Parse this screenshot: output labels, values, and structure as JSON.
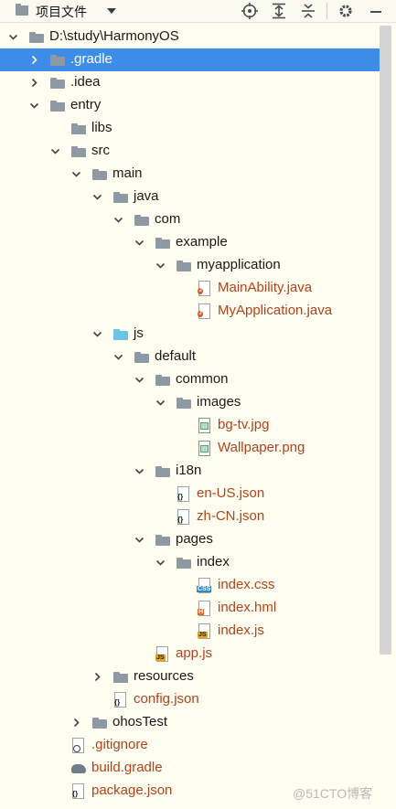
{
  "toolbar": {
    "project_label": "项目文件",
    "buttons": [
      "locate-icon",
      "expand-all-icon",
      "collapse-all-icon",
      "gear-icon",
      "minimize-icon"
    ]
  },
  "tree": [
    {
      "label": "D:\\study\\HarmonyOS",
      "depth": 0,
      "expanded": true,
      "icon": "folder",
      "selected": false
    },
    {
      "label": ".gradle",
      "depth": 1,
      "expanded": false,
      "icon": "folder",
      "selected": true
    },
    {
      "label": ".idea",
      "depth": 1,
      "expanded": false,
      "icon": "folder",
      "selected": false
    },
    {
      "label": "entry",
      "depth": 1,
      "expanded": true,
      "icon": "folder",
      "selected": false
    },
    {
      "label": "libs",
      "depth": 2,
      "icon": "folder",
      "selected": false
    },
    {
      "label": "src",
      "depth": 2,
      "expanded": true,
      "icon": "folder",
      "selected": false
    },
    {
      "label": "main",
      "depth": 3,
      "expanded": true,
      "icon": "folder",
      "selected": false
    },
    {
      "label": "java",
      "depth": 4,
      "expanded": true,
      "icon": "folder",
      "selected": false
    },
    {
      "label": "com",
      "depth": 5,
      "expanded": true,
      "icon": "folder",
      "selected": false
    },
    {
      "label": "example",
      "depth": 6,
      "expanded": true,
      "icon": "folder",
      "selected": false
    },
    {
      "label": "myapplication",
      "depth": 7,
      "expanded": true,
      "icon": "folder",
      "selected": false
    },
    {
      "label": "MainAbility.java",
      "depth": 8,
      "icon": "java-file",
      "red": true
    },
    {
      "label": "MyApplication.java",
      "depth": 8,
      "icon": "java-file",
      "red": true
    },
    {
      "label": "js",
      "depth": 4,
      "expanded": true,
      "icon": "folder-blue",
      "selected": false
    },
    {
      "label": "default",
      "depth": 5,
      "expanded": true,
      "icon": "folder",
      "selected": false
    },
    {
      "label": "common",
      "depth": 6,
      "expanded": true,
      "icon": "folder",
      "selected": false
    },
    {
      "label": "images",
      "depth": 7,
      "expanded": true,
      "icon": "folder",
      "selected": false
    },
    {
      "label": "bg-tv.jpg",
      "depth": 8,
      "icon": "image-file",
      "red": true
    },
    {
      "label": "Wallpaper.png",
      "depth": 8,
      "icon": "image-file",
      "red": true
    },
    {
      "label": "i18n",
      "depth": 6,
      "expanded": true,
      "icon": "folder",
      "selected": false
    },
    {
      "label": "en-US.json",
      "depth": 7,
      "icon": "json-file",
      "red": true
    },
    {
      "label": "zh-CN.json",
      "depth": 7,
      "icon": "json-file",
      "red": true
    },
    {
      "label": "pages",
      "depth": 6,
      "expanded": true,
      "icon": "folder",
      "selected": false
    },
    {
      "label": "index",
      "depth": 7,
      "expanded": true,
      "icon": "folder",
      "selected": false
    },
    {
      "label": "index.css",
      "depth": 8,
      "icon": "css-file",
      "red": true
    },
    {
      "label": "index.hml",
      "depth": 8,
      "icon": "hml-file",
      "red": true
    },
    {
      "label": "index.js",
      "depth": 8,
      "icon": "js-file",
      "red": true
    },
    {
      "label": "app.js",
      "depth": 6,
      "icon": "js-file",
      "red": true
    },
    {
      "label": "resources",
      "depth": 4,
      "expanded": false,
      "icon": "folder",
      "selected": false
    },
    {
      "label": "config.json",
      "depth": 4,
      "icon": "json-file",
      "red": true
    },
    {
      "label": "ohosTest",
      "depth": 3,
      "expanded": false,
      "icon": "folder",
      "selected": false
    },
    {
      "label": ".gitignore",
      "depth": 2,
      "icon": "gitignore-file",
      "red": true
    },
    {
      "label": "build.gradle",
      "depth": 2,
      "icon": "gradle-file",
      "red": true
    },
    {
      "label": "package.json",
      "depth": 2,
      "icon": "json-file",
      "red": true
    }
  ],
  "watermark": "@51CTO博客",
  "colors": {
    "selected": "#3d8de8",
    "background": "#fffef0",
    "modified_text": "#b0431d"
  }
}
